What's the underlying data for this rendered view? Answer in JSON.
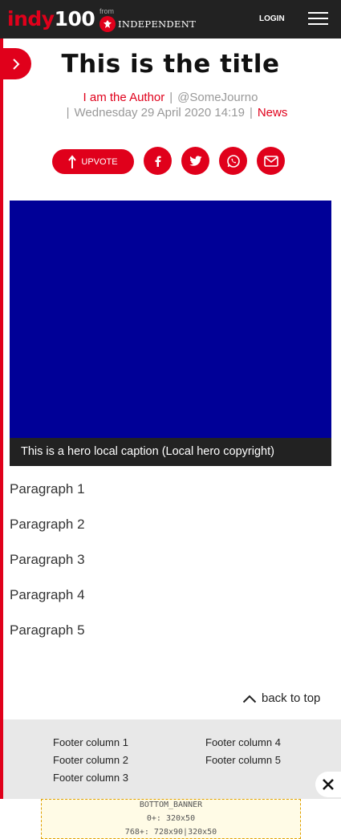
{
  "header": {
    "logo_main": "indy",
    "logo_num": "100",
    "from_label": "from",
    "partner_name": "INDEPENDENT",
    "login_label": "LOGIN"
  },
  "article": {
    "title": "This is the title",
    "author": "I am the Author",
    "handle": "@SomeJourno",
    "date": "Wednesday 29 April 2020 14:19",
    "category": "News",
    "separator": "|"
  },
  "share": {
    "upvote_label": "UPVOTE",
    "buttons": [
      "facebook-icon",
      "twitter-icon",
      "whatsapp-icon",
      "email-icon"
    ]
  },
  "hero": {
    "caption": "This is a hero local caption (Local hero copyright)",
    "color": "#000097"
  },
  "paragraphs": [
    "Paragraph 1",
    "Paragraph 2",
    "Paragraph 3",
    "Paragraph 4",
    "Paragraph 5"
  ],
  "back_to_top": "back to top",
  "footer": {
    "columns": [
      "Footer column 1",
      "Footer column 2",
      "Footer column 3",
      "Footer column 4",
      "Footer column 5"
    ]
  },
  "banner": {
    "lines": [
      "BOTTOM_BANNER",
      "0+: 320x50",
      "768+: 728x90|320x50"
    ]
  },
  "colors": {
    "accent": "#e0001b",
    "header_bg": "#222222",
    "footer_bg": "#e8e8e8"
  }
}
